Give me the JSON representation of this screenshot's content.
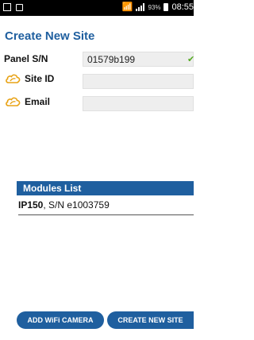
{
  "status_bar": {
    "battery_percent": "93%",
    "time": "08:55"
  },
  "page": {
    "title": "Create New Site"
  },
  "form": {
    "panel_sn": {
      "label": "Panel S/N",
      "value": "01579b199"
    },
    "site_id": {
      "label": "Site ID",
      "value": ""
    },
    "email": {
      "label": "Email",
      "value": ""
    }
  },
  "modules": {
    "header": "Modules List",
    "items": [
      {
        "name": "IP150",
        "serial": ", S/N e1003759"
      }
    ]
  },
  "buttons": {
    "add_wifi_camera": "ADD WiFi CAMERA",
    "create_new_site": "CREATE NEW SITE"
  },
  "colors": {
    "accent": "#1f5f9f",
    "status_bar": "#000000",
    "field_bg": "#eeeeee",
    "check": "#55aa22",
    "cloud_icon": "#e8a317"
  },
  "icons": {
    "site_id": "cloud-icon",
    "email": "cloud-icon",
    "panel_sn_status": "check-icon"
  }
}
